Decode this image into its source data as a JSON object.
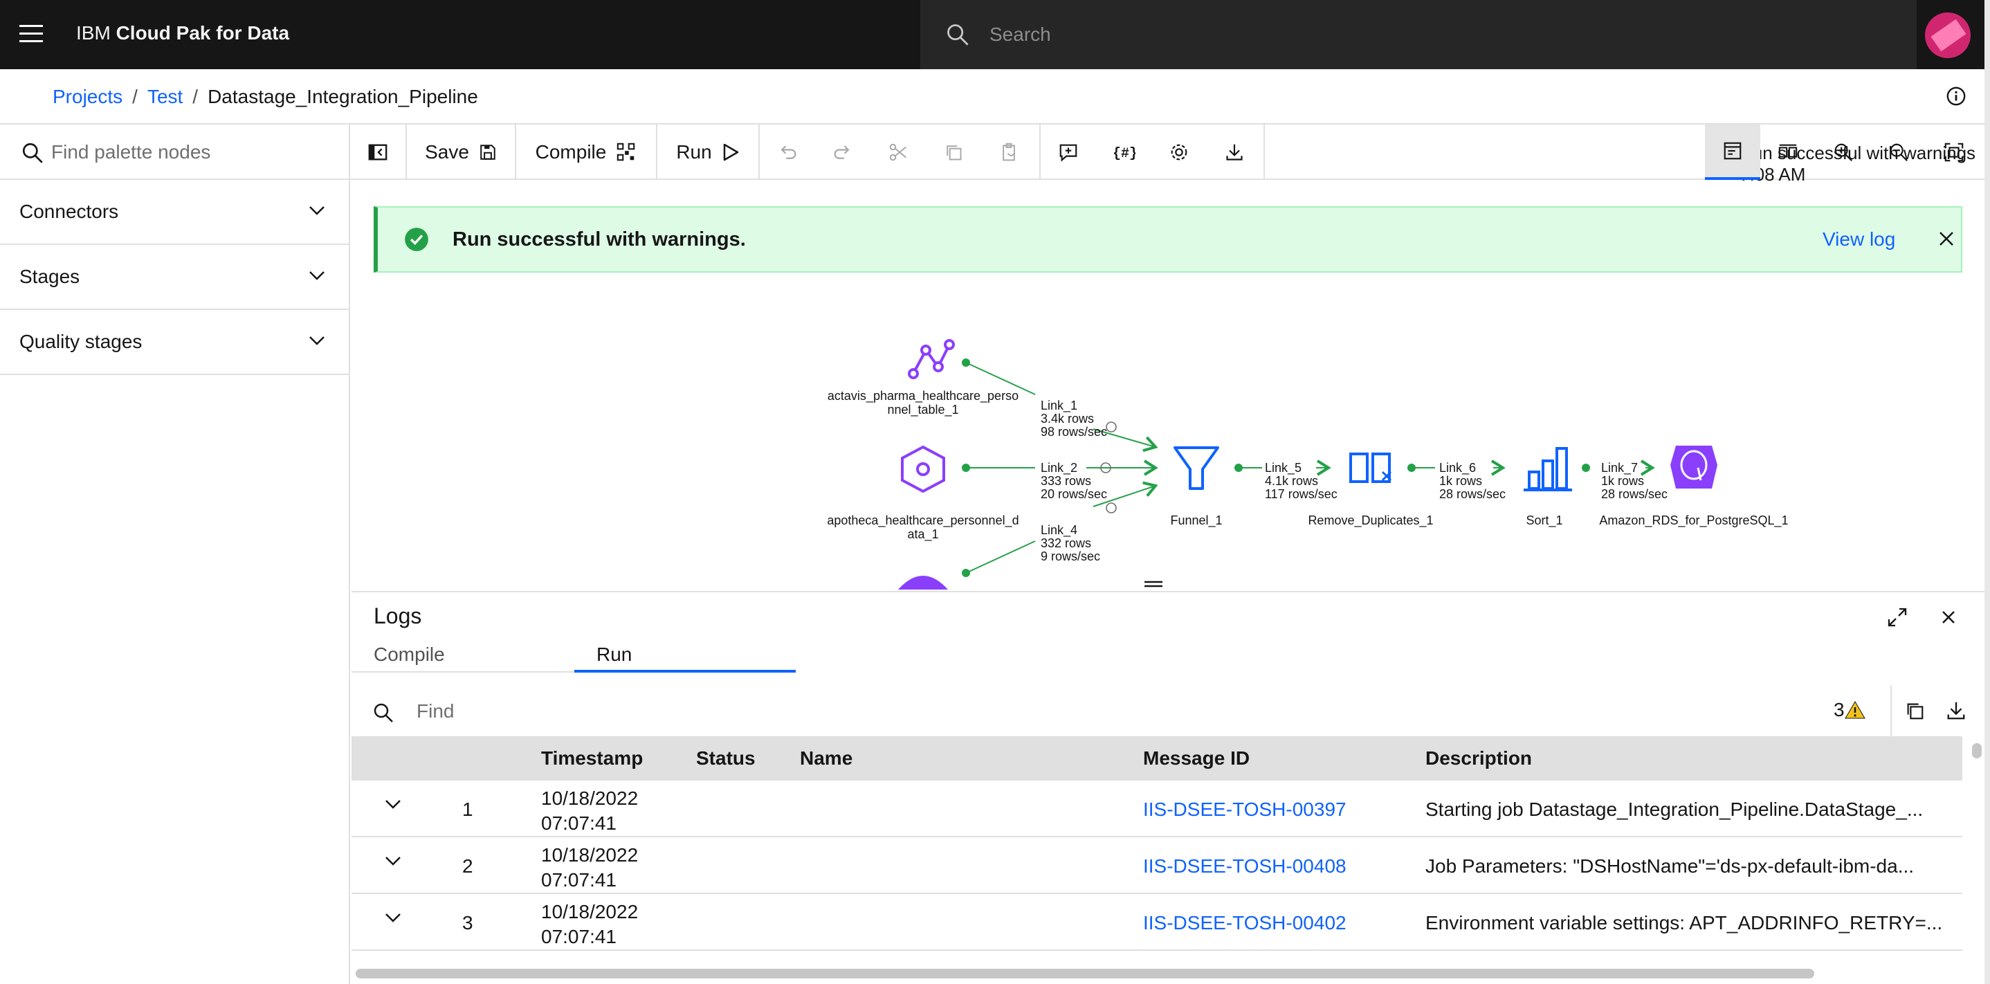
{
  "header": {
    "brand_prefix": "IBM",
    "brand_name": "Cloud Pak for Data",
    "search_placeholder": "Search"
  },
  "breadcrumb": {
    "items": [
      "Projects",
      "Test"
    ],
    "current": "Datastage_Integration_Pipeline"
  },
  "palette": {
    "search_placeholder": "Find palette nodes",
    "sections": [
      "Connectors",
      "Stages",
      "Quality stages"
    ]
  },
  "toolbar": {
    "save": "Save",
    "compile": "Compile",
    "run": "Run",
    "status": "Run successful with warnings 7:08 AM"
  },
  "notification": {
    "message": "Run successful with warnings.",
    "link": "View log"
  },
  "flow": {
    "nodes": {
      "src1": [
        "actavis_pharma_healthcare_perso",
        "nnel_table_1"
      ],
      "src2": [
        "apotheca_healthcare_personnel_d",
        "ata_1"
      ],
      "funnel": "Funnel_1",
      "dedup": "Remove_Duplicates_1",
      "sort": "Sort_1",
      "target": "Amazon_RDS_for_PostgreSQL_1"
    },
    "links": {
      "l1": [
        "Link_1",
        "3.4k rows",
        "98 rows/sec"
      ],
      "l2": [
        "Link_2",
        "333 rows",
        "20 rows/sec"
      ],
      "l4": [
        "Link_4",
        "332 rows",
        "9 rows/sec"
      ],
      "l5": [
        "Link_5",
        "4.1k rows",
        "117 rows/sec"
      ],
      "l6": [
        "Link_6",
        "1k rows",
        "28 rows/sec"
      ],
      "l7": [
        "Link_7",
        "1k rows",
        "28 rows/sec"
      ]
    }
  },
  "logs": {
    "title": "Logs",
    "tabs": [
      "Compile",
      "Run"
    ],
    "find_placeholder": "Find",
    "warning_count": "3",
    "columns": [
      "Timestamp",
      "Status",
      "Name",
      "Message ID",
      "Description"
    ],
    "rows": [
      {
        "num": "1",
        "date": "10/18/2022",
        "time": "07:07:41",
        "msgid": "IIS-DSEE-TOSH-00397",
        "desc": "Starting job Datastage_Integration_Pipeline.DataStage_..."
      },
      {
        "num": "2",
        "date": "10/18/2022",
        "time": "07:07:41",
        "msgid": "IIS-DSEE-TOSH-00408",
        "desc": "Job Parameters: \"DSHostName\"='ds-px-default-ibm-da..."
      },
      {
        "num": "3",
        "date": "10/18/2022",
        "time": "07:07:41",
        "msgid": "IIS-DSEE-TOSH-00402",
        "desc": "Environment variable settings: APT_ADDRINFO_RETRY=..."
      }
    ]
  },
  "colors": {
    "accent": "#0f62fe",
    "success": "#24a148",
    "node_purple": "#8a3ffc",
    "node_blue": "#0f62fe"
  }
}
